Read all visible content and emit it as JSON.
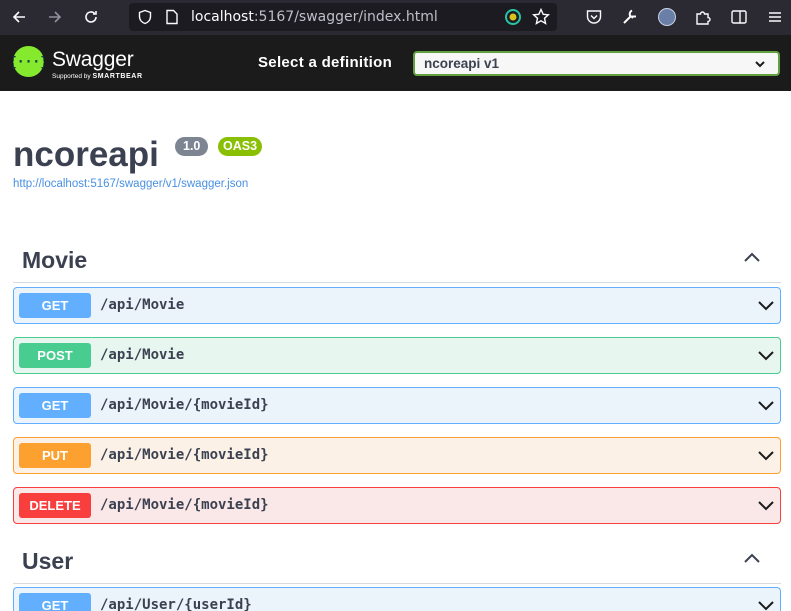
{
  "browser": {
    "url_host": "localhost",
    "url_rest": ":5167/swagger/index.html"
  },
  "topbar": {
    "logo_name": "Swagger",
    "logo_supported_prefix": "Supported by ",
    "logo_supported_brand": "SMARTBEAR",
    "select_label": "Select a definition",
    "selected_definition": "ncoreapi v1",
    "accent_color": "#85ea2d"
  },
  "info": {
    "title": "ncoreapi",
    "version": "1.0",
    "oas": "OAS3",
    "spec_url": "http://localhost:5167/swagger/v1/swagger.json"
  },
  "sections": [
    {
      "name": "Movie",
      "operations": [
        {
          "method": "GET",
          "path": "/api/Movie"
        },
        {
          "method": "POST",
          "path": "/api/Movie"
        },
        {
          "method": "GET",
          "path": "/api/Movie/{movieId}"
        },
        {
          "method": "PUT",
          "path": "/api/Movie/{movieId}"
        },
        {
          "method": "DELETE",
          "path": "/api/Movie/{movieId}"
        }
      ]
    },
    {
      "name": "User",
      "operations": [
        {
          "method": "GET",
          "path": "/api/User/{userId}"
        }
      ]
    }
  ],
  "method_colors": {
    "GET": "#61affe",
    "POST": "#49cc90",
    "PUT": "#fca130",
    "DELETE": "#f93e3e"
  }
}
